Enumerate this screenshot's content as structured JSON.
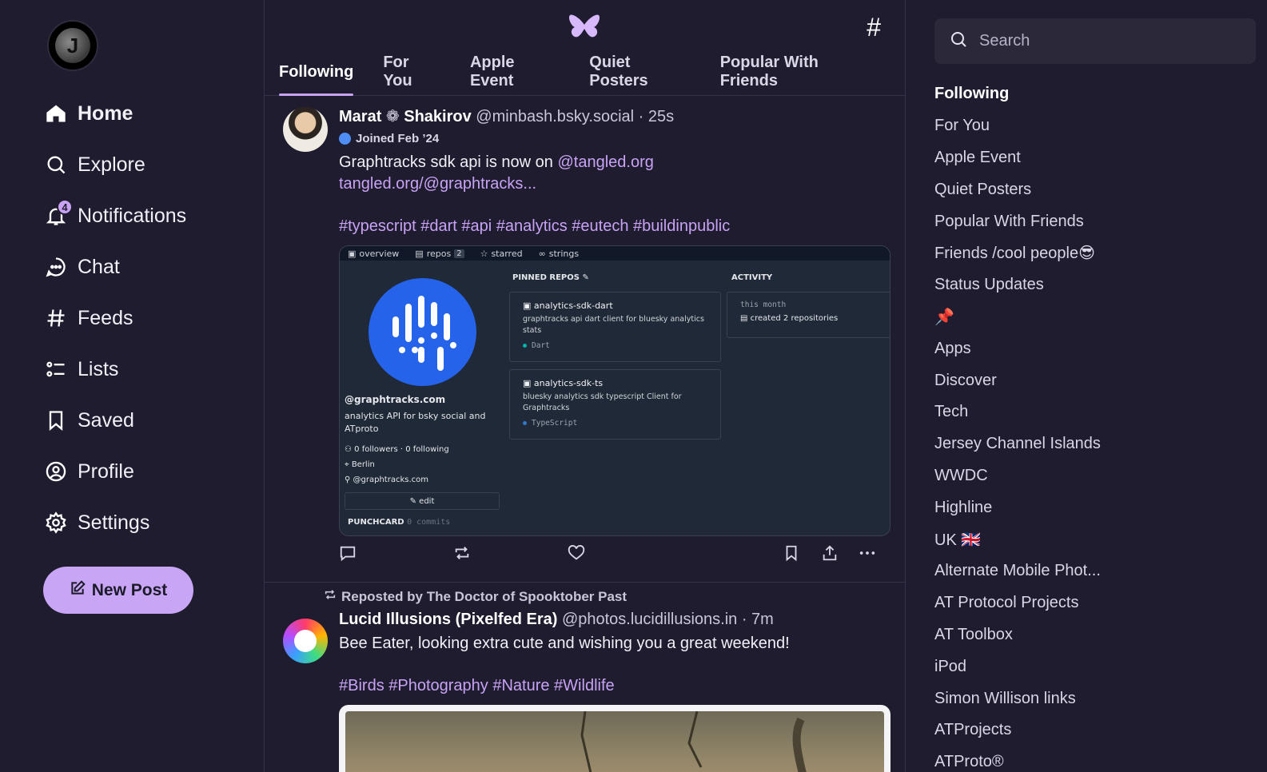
{
  "nav": {
    "items": [
      {
        "label": "Home",
        "icon": "home-icon",
        "active": true
      },
      {
        "label": "Explore",
        "icon": "search-icon"
      },
      {
        "label": "Notifications",
        "icon": "bell-icon",
        "badge": "4"
      },
      {
        "label": "Chat",
        "icon": "chat-icon"
      },
      {
        "label": "Feeds",
        "icon": "hash-icon"
      },
      {
        "label": "Lists",
        "icon": "list-icon"
      },
      {
        "label": "Saved",
        "icon": "bookmark-icon"
      },
      {
        "label": "Profile",
        "icon": "profile-icon"
      },
      {
        "label": "Settings",
        "icon": "gear-icon"
      }
    ],
    "new_post": "New Post",
    "avatar_letter": "J"
  },
  "tabs": [
    "Following",
    "For You",
    "Apple Event",
    "Quiet Posters",
    "Popular With Friends"
  ],
  "post1": {
    "name_first": "Marat",
    "name_last": "Shakirov",
    "handle": "@minbash.bsky.social",
    "time": "· 25s",
    "joined": "Joined Feb ’24",
    "text": "Graphtracks sdk api is now on ",
    "mention": "@tangled.org",
    "link": "tangled.org/@graphtracks...",
    "tags": "#typescript #dart #api #analytics #eutech #buildinpublic",
    "embed": {
      "tabs": [
        "overview",
        "repos",
        "starred",
        "strings"
      ],
      "repos_count": "2",
      "handle": "@graphtracks.com",
      "desc": "analytics API for bsky social and ATproto",
      "followers": "0 followers",
      "following": "0 following",
      "location": "Berlin",
      "link": "@graphtracks.com",
      "edit": "edit",
      "punchcard": "PUNCHCARD",
      "commits": "0 commits",
      "pinned_label": "PINNED REPOS",
      "repos": [
        {
          "name": "analytics-sdk-dart",
          "desc": "graphtracks api dart client for bluesky analytics stats",
          "lang": "Dart",
          "lang_color": "#00b4ab"
        },
        {
          "name": "analytics-sdk-ts",
          "desc": "bluesky analytics sdk typescript Client for Graphtracks",
          "lang": "TypeScript",
          "lang_color": "#3178c6"
        }
      ],
      "activity_label": "ACTIVITY",
      "activity_month": "this month",
      "activity_text": "created 2 repositories"
    }
  },
  "post2": {
    "repost_by": "Reposted by The Doctor of Spooktober Past",
    "name": "Lucid Illusions (Pixelfed Era)",
    "handle": "@photos.lucidillusions.in",
    "time": "· 7m",
    "text": "Bee Eater, looking extra cute and wishing you a great weekend!",
    "tags": "#Birds #Photography #Nature #Wildlife"
  },
  "search": {
    "placeholder": "Search"
  },
  "feeds": [
    "Following",
    "For You",
    "Apple Event",
    "Quiet Posters",
    "Popular With Friends",
    "Friends /cool people😎",
    "Status Updates",
    "📌",
    "Apps",
    "Discover",
    "Tech",
    "Jersey Channel Islands",
    "WWDC",
    "Highline",
    "UK 🇬🇧",
    "Alternate Mobile Phot...",
    "AT Protocol Projects",
    "AT Toolbox",
    "iPod",
    "Simon Willison links",
    "ATProjects",
    "ATProto®"
  ],
  "colors": {
    "accent": "#c8a3f5",
    "background": "#1e1c2e",
    "butterfly": "#d7b8fa"
  }
}
